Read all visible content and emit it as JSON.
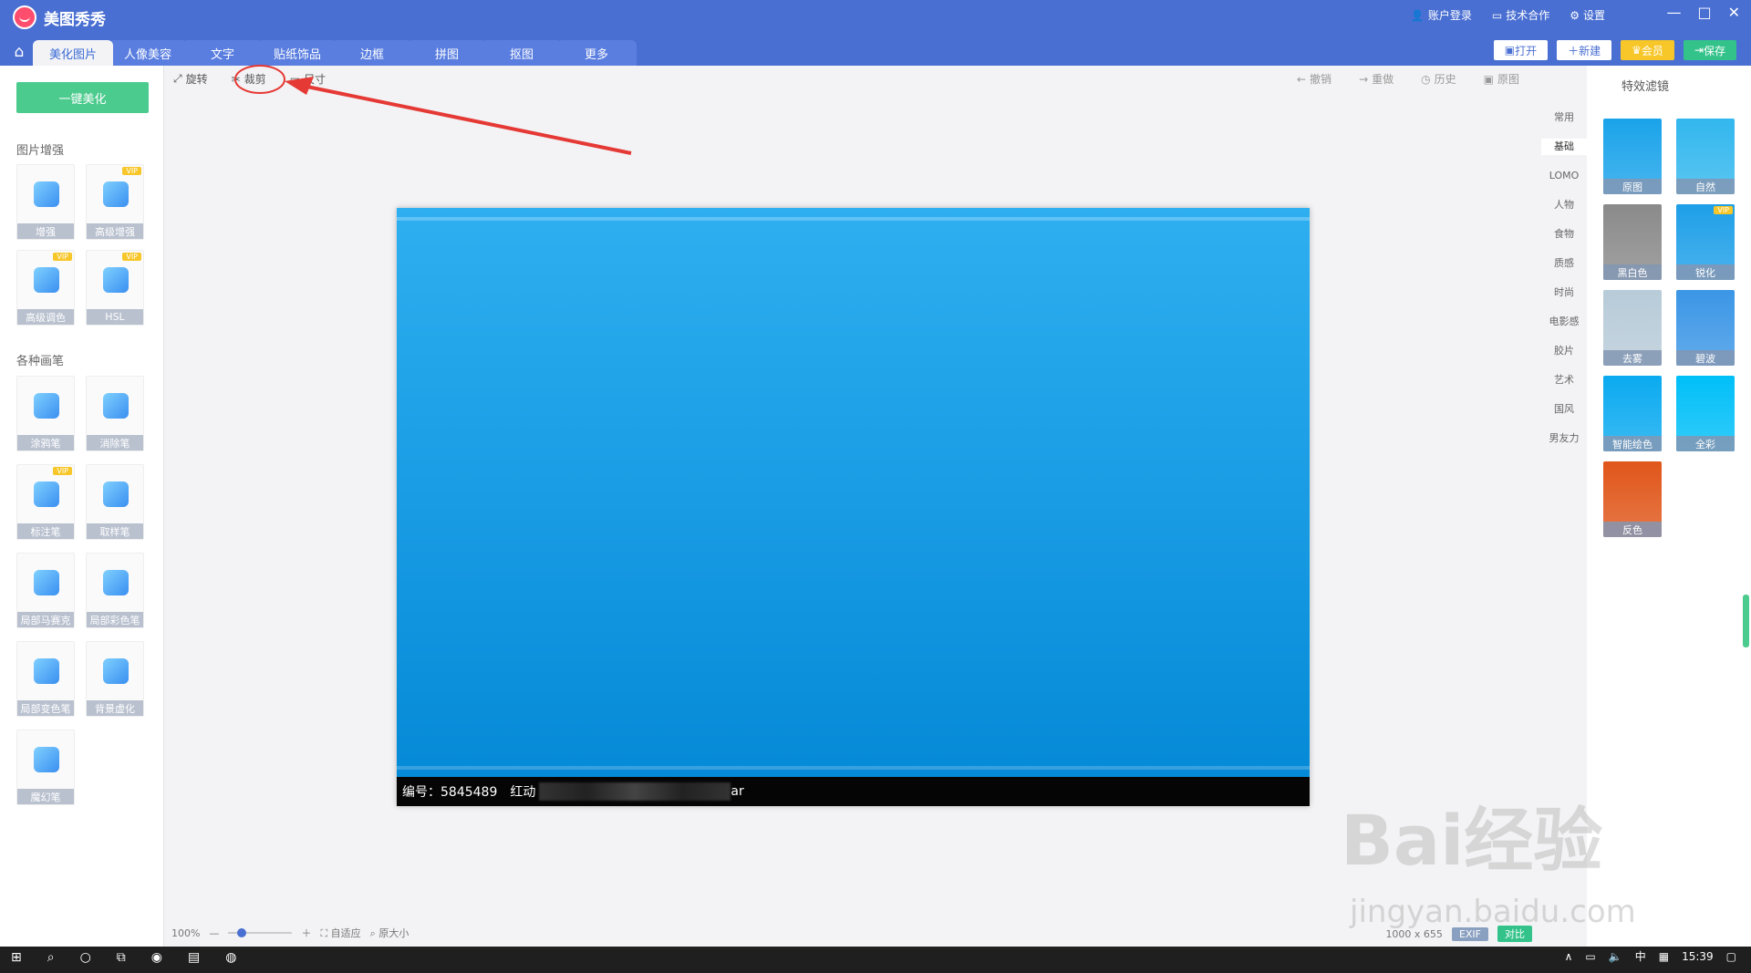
{
  "app": {
    "title": "美图秀秀"
  },
  "header_links": {
    "account": "账户登录",
    "tech": "技术合作",
    "settings": "设置"
  },
  "tabs": [
    "美化图片",
    "人像美容",
    "文字",
    "贴纸饰品",
    "边框",
    "拼图",
    "抠图",
    "更多"
  ],
  "top_buttons": {
    "open": "打开",
    "new": "新建",
    "vip": "会员",
    "save": "保存"
  },
  "left": {
    "one_key": "一键美化",
    "section1": "图片增强",
    "section2": "各种画笔",
    "tools1": [
      {
        "label": "增强",
        "icon": "sliders-icon",
        "vip": false
      },
      {
        "label": "高级增强",
        "icon": "sparkle-icon",
        "vip": true
      },
      {
        "label": "高级调色",
        "icon": "palette-icon",
        "vip": true
      },
      {
        "label": "HSL",
        "icon": "hsl-sliders-icon",
        "vip": true
      }
    ],
    "tools2": [
      {
        "label": "涂鸦笔",
        "icon": "brush-icon",
        "vip": false
      },
      {
        "label": "消除笔",
        "icon": "eraser-icon",
        "vip": false
      },
      {
        "label": "标注笔",
        "icon": "pen-icon",
        "vip": true
      },
      {
        "label": "取样笔",
        "icon": "sampler-icon",
        "vip": false
      },
      {
        "label": "局部马赛克",
        "icon": "mosaic-icon",
        "vip": false
      },
      {
        "label": "局部彩色笔",
        "icon": "color-brush-icon",
        "vip": false
      },
      {
        "label": "局部变色笔",
        "icon": "recolor-pen-icon",
        "vip": false
      },
      {
        "label": "背景虚化",
        "icon": "blur-icon",
        "vip": false
      },
      {
        "label": "魔幻笔",
        "icon": "magic-pen-icon",
        "vip": false
      }
    ],
    "vip_badge": "VIP"
  },
  "edit_toolbar": {
    "rotate": "旋转",
    "crop": "裁剪",
    "size": "尺寸"
  },
  "history_toolbar": {
    "undo": "撤销",
    "redo": "重做",
    "history": "历史",
    "original": "原图"
  },
  "image": {
    "caption_id": "编号：5845489",
    "caption_name": "红动",
    "caption_tail": "ar"
  },
  "right": {
    "title": "特效滤镜",
    "categories": [
      "常用",
      "基础",
      "LOMO",
      "人物",
      "食物",
      "质感",
      "时尚",
      "电影感",
      "胶片",
      "艺术",
      "国风",
      "男友力"
    ],
    "active_category": "基础",
    "filters": [
      {
        "label": "原图",
        "color": "#1aa3ea",
        "vip": false
      },
      {
        "label": "自然",
        "color": "#32b7ee",
        "vip": false
      },
      {
        "label": "黑白色",
        "color": "#8a8a8a",
        "vip": false
      },
      {
        "label": "锐化",
        "color": "#1e9fe8",
        "vip": true
      },
      {
        "label": "去雾",
        "color": "#b7cbd8",
        "vip": false
      },
      {
        "label": "碧波",
        "color": "#3b96e6",
        "vip": false
      },
      {
        "label": "智能绘色",
        "color": "#0aaaf0",
        "vip": false
      },
      {
        "label": "全彩",
        "color": "#00bff8",
        "vip": false
      },
      {
        "label": "反色",
        "color": "#e0561a",
        "vip": false
      }
    ]
  },
  "bottom": {
    "zoom": "100%",
    "fit": "自适应",
    "actual": "原大小",
    "dims": "1000 x 655",
    "exif": "EXIF",
    "compare": "对比"
  },
  "taskbar": {
    "time": "15:39",
    "ime": "中"
  },
  "watermark": {
    "main": "Bai经验",
    "sub": "jingyan.baidu.com"
  }
}
